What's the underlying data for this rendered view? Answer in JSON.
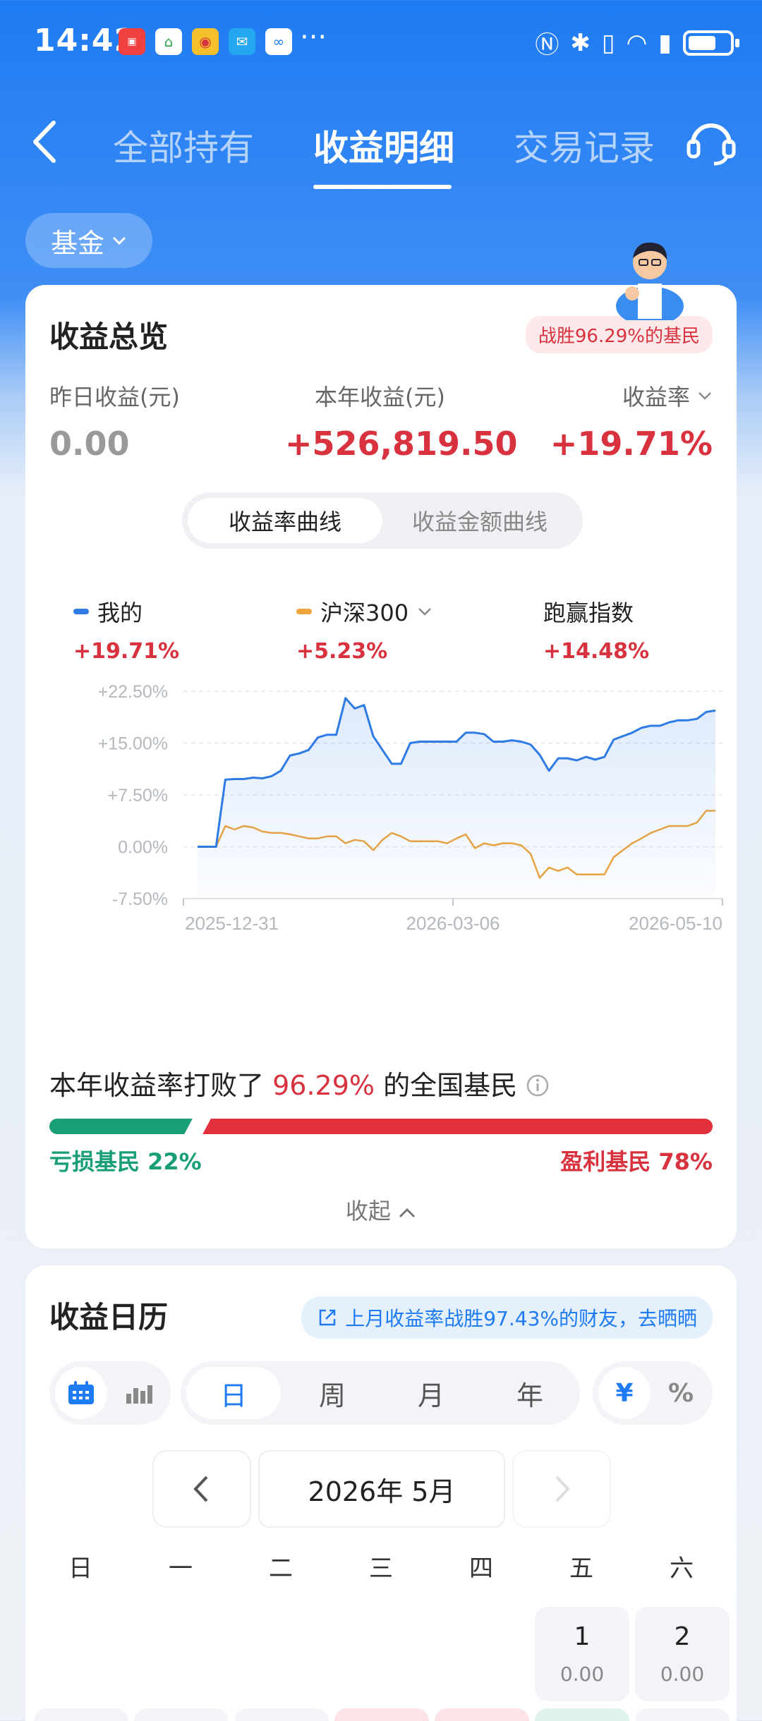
{
  "status_bar": {
    "time": "14:42",
    "dots": "···"
  },
  "nav": {
    "tabs": [
      "全部持有",
      "收益明细",
      "交易记录"
    ],
    "active_tab_index": 1
  },
  "filter": {
    "label": "基金"
  },
  "overview": {
    "title": "收益总览",
    "badge": "战胜96.29%的基民",
    "yesterday_label": "昨日收益(元)",
    "yesterday_value": "0.00",
    "year_label": "本年收益(元)",
    "year_value": "+526,819.50",
    "rate_label": "收益率",
    "rate_value": "+19.71%",
    "curve_tabs": [
      "收益率曲线",
      "收益金额曲线"
    ],
    "legend": [
      {
        "name": "我的",
        "value": "+19.71%",
        "color": "#2f7be6"
      },
      {
        "name": "沪深300",
        "value": "+5.23%",
        "color": "#f0a53a"
      },
      {
        "name": "跑赢指数",
        "value": "+14.48%"
      }
    ],
    "beat_prefix": "本年收益率打败了",
    "beat_value": "96.29%",
    "beat_suffix": "的全国基民",
    "loss_label": "亏损基民 22%",
    "gain_label": "盈利基民 78%",
    "loss_share": 0.22,
    "collapse_label": "收起"
  },
  "chart_data": {
    "type": "line",
    "y_ticks": [
      "+22.50%",
      "+15.00%",
      "+7.50%",
      "0.00%",
      "-7.50%"
    ],
    "ylim": [
      -7.5,
      22.5
    ],
    "x_tick_labels": [
      "2025-12-31",
      "2026-03-06",
      "2026-05-10"
    ],
    "series": [
      {
        "name": "我的",
        "color": "#2f7be6",
        "values": [
          0,
          0,
          0,
          9.7,
          9.8,
          9.8,
          10,
          9.9,
          10.2,
          11,
          13.2,
          13.5,
          14,
          15.8,
          16.2,
          16.2,
          21.5,
          20,
          20.5,
          16,
          14,
          12,
          12,
          15,
          15.2,
          15.2,
          15.2,
          15.2,
          15.2,
          16.5,
          16.5,
          16.3,
          15.2,
          15.2,
          15.4,
          15.2,
          14.8,
          13.3,
          11,
          12.8,
          12.8,
          12.5,
          13,
          12.6,
          13,
          15.5,
          16,
          16.5,
          17.2,
          17.5,
          17.5,
          18,
          18.3,
          18.3,
          18.5,
          19.5,
          19.7
        ]
      },
      {
        "name": "沪深300",
        "color": "#f0a53a",
        "values": [
          0,
          0,
          0,
          3,
          2.5,
          3,
          2.8,
          2.2,
          2,
          2,
          1.8,
          1.5,
          1.2,
          1.2,
          1.5,
          1.5,
          0.5,
          1,
          0.8,
          -0.5,
          1,
          2,
          1.5,
          0.8,
          0.8,
          0.8,
          0.8,
          0.5,
          1.2,
          1.8,
          -0.2,
          0.5,
          0.2,
          0.5,
          0.5,
          0.2,
          -1,
          -4.5,
          -3,
          -3.5,
          -3,
          -4,
          -4,
          -4,
          -4,
          -1.5,
          -0.5,
          0.5,
          1.2,
          2,
          2.5,
          3,
          3,
          3,
          3.5,
          5.2,
          5.2
        ]
      }
    ]
  },
  "calendar": {
    "title": "收益日历",
    "share_text": "上月收益率战胜97.43%的财友，去晒晒",
    "periods": [
      "日",
      "周",
      "月",
      "年"
    ],
    "active_period": 0,
    "units": [
      "¥",
      "%"
    ],
    "month": "2026年 5月",
    "weekdays": [
      "日",
      "一",
      "二",
      "三",
      "四",
      "五",
      "六"
    ],
    "days": [
      {
        "day": "1",
        "value": "0.00",
        "col": 5
      },
      {
        "day": "2",
        "value": "0.00",
        "col": 6
      }
    ]
  }
}
